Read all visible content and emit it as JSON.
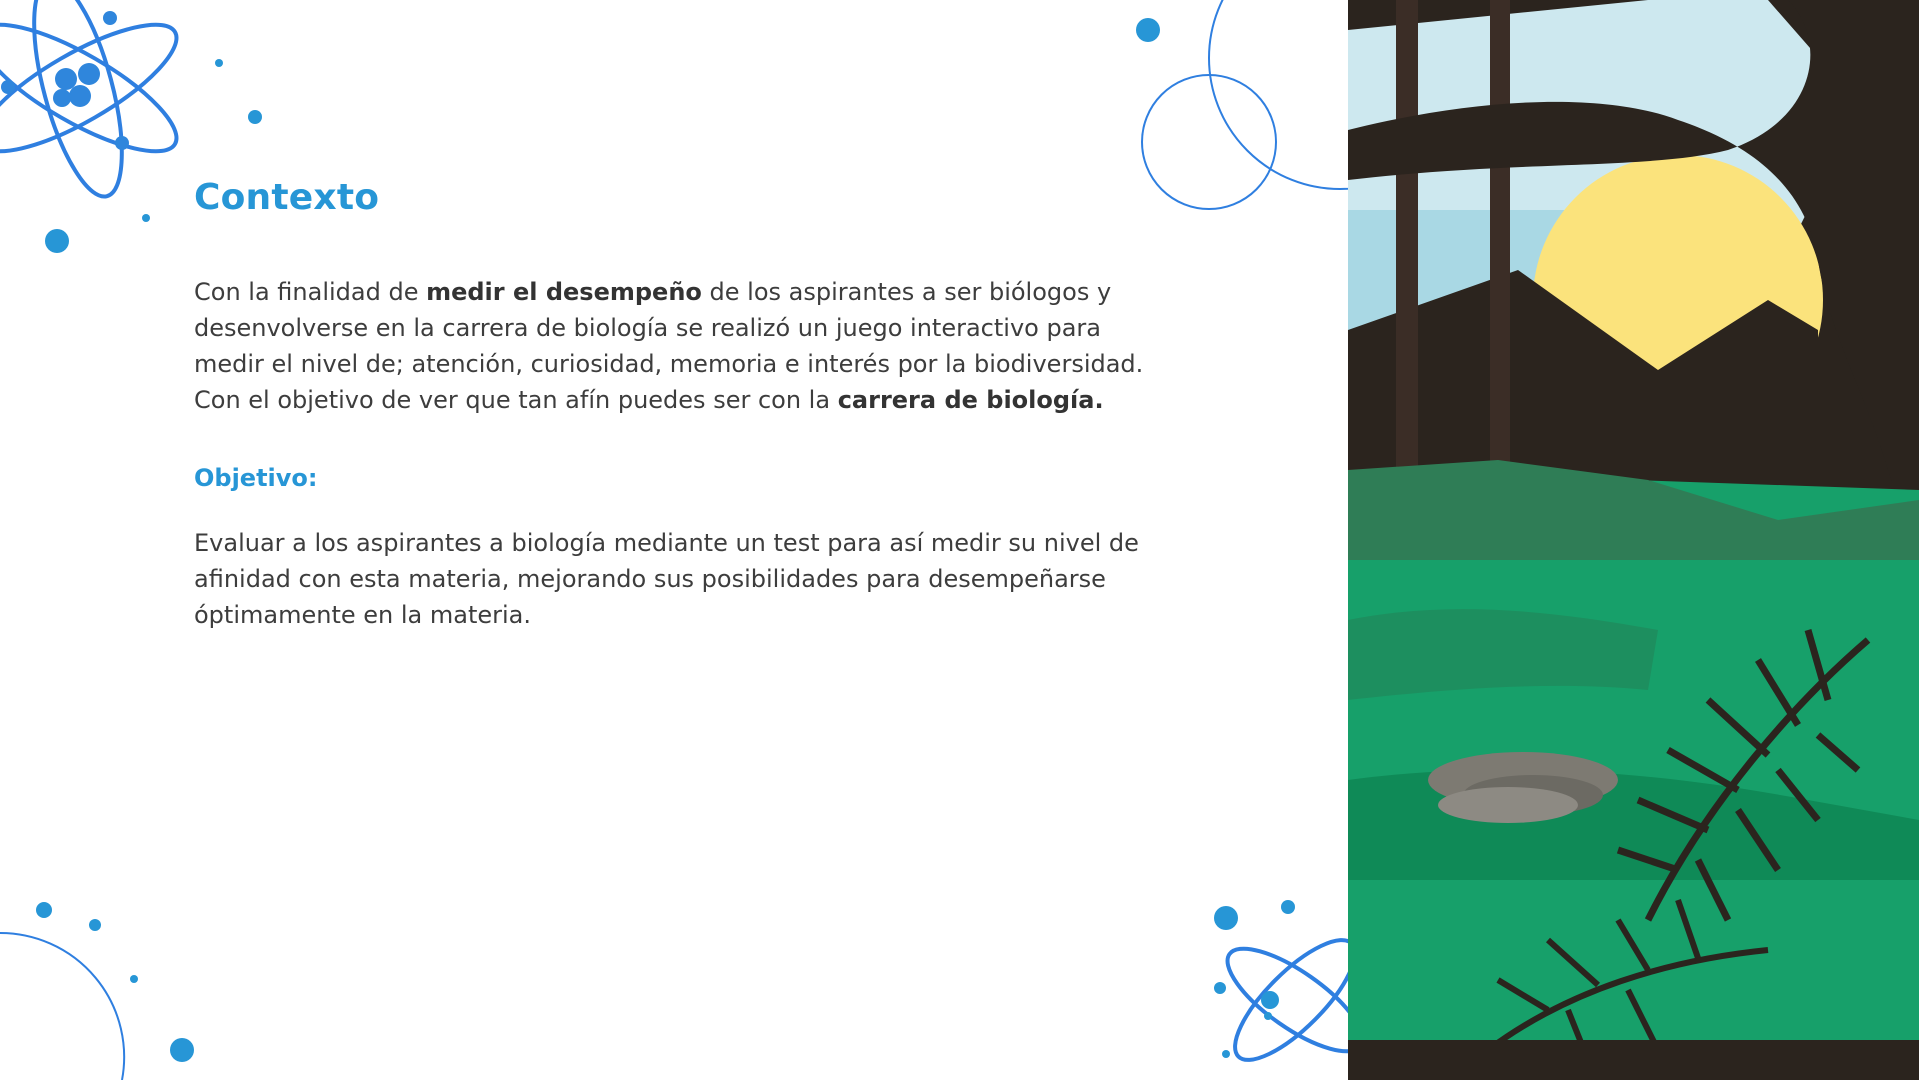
{
  "content": {
    "title": "Contexto",
    "intro": {
      "t1": "Con la finalidad de ",
      "b1": "medir el desempeño",
      "t2": " de los aspirantes a ser biólogos y desenvolverse en la carrera de biología se realizó un juego interactivo para medir el nivel de; atención, curiosidad, memoria e interés por la biodiversidad. Con el objetivo de ver que tan afín puedes ser con la ",
      "b2": "carrera de biología."
    },
    "objective_heading": "Objetivo:",
    "objective_text": "Evaluar a los aspirantes a biología mediante un test para así medir su nivel de afinidad con esta materia, mejorando sus posibilidades para desempeñarse óptimamente en la materia."
  },
  "theme": {
    "accent": "#2796d6",
    "decoration_blue": "#2f7fe0",
    "text": "#3d3d3d",
    "forest_green": "#17a06a",
    "tree_dark": "#2b241e",
    "sun_yellow": "#fbe37c",
    "sky": "#cde8ef"
  },
  "icons": {
    "atom_top_left": "atom-icon",
    "atom_bottom_right": "atom-icon",
    "rings": "ring-circle-icon"
  }
}
